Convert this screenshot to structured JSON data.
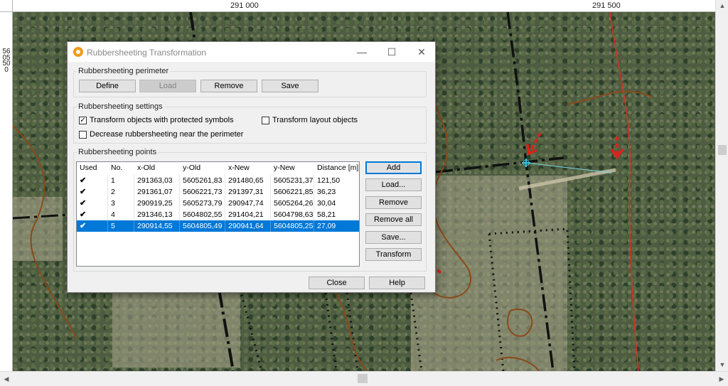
{
  "ruler": {
    "x_ticks": [
      "291 000",
      "291 500"
    ],
    "y_label": "5605500"
  },
  "dialog": {
    "title": "Rubbersheeting Transformation",
    "window_controls": {
      "minimize": "—",
      "maximize": "☐",
      "close": "✕"
    },
    "perimeter": {
      "title": "Rubbersheeting perimeter",
      "buttons": {
        "define": "Define",
        "load": "Load",
        "remove": "Remove",
        "save": "Save"
      }
    },
    "settings": {
      "title": "Rubbersheeting settings",
      "transform_protected": {
        "label": "Transform objects with protected symbols",
        "checked": true
      },
      "transform_layout": {
        "label": "Transform layout objects",
        "checked": false
      },
      "decrease_near_perimeter": {
        "label": "Decrease rubbersheeting near the perimeter",
        "checked": false
      }
    },
    "points": {
      "title": "Rubbersheeting points",
      "columns": [
        "Used",
        "No.",
        "x-Old",
        "y-Old",
        "x-New",
        "y-New",
        "Distance [m]"
      ],
      "rows": [
        [
          "✔",
          "1",
          "291363,03",
          "5605261,83",
          "291480,65",
          "5605231,37",
          "121,50"
        ],
        [
          "✔",
          "2",
          "291361,07",
          "5606221,73",
          "291397,31",
          "5606221,85",
          "36,23"
        ],
        [
          "✔",
          "3",
          "290919,25",
          "5605273,79",
          "290947,74",
          "5605264,26",
          "30,04"
        ],
        [
          "✔",
          "4",
          "291346,13",
          "5604802,55",
          "291404,21",
          "5604798,63",
          "58,21"
        ],
        [
          "✔",
          "5",
          "290914,55",
          "5604805,49",
          "290941,64",
          "5604805,25",
          "27,09"
        ]
      ],
      "selected_row": 5,
      "buttons": {
        "add": "Add",
        "load": "Load...",
        "remove": "Remove",
        "remove_all": "Remove all",
        "save": "Save...",
        "transform": "Transform"
      }
    },
    "footer": {
      "close": "Close",
      "help": "Help"
    }
  },
  "scrollbar": {
    "up": "▲",
    "down": "▼",
    "left": "◀",
    "right": "▶"
  },
  "colors": {
    "selection": "#0078d7",
    "annotation_arrow": "#e0201a",
    "app_icon": "#f29a1a"
  }
}
